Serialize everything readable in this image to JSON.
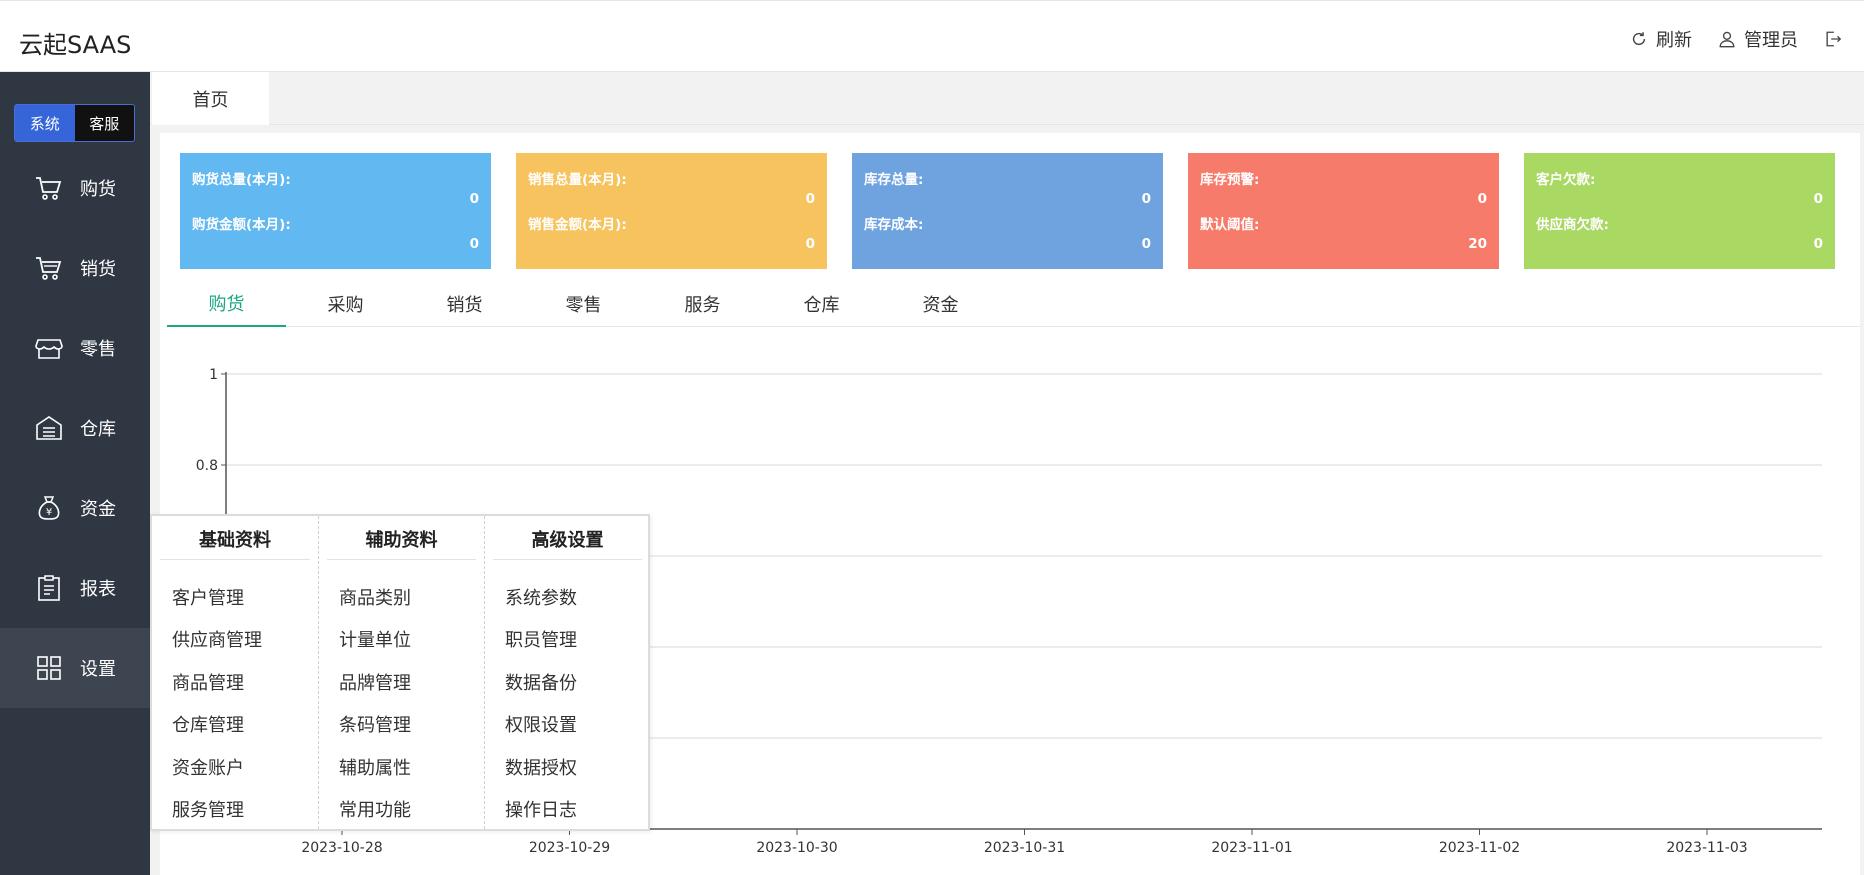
{
  "header": {
    "brand": "云起SAAS",
    "refresh": "刷新",
    "user": "管理员"
  },
  "sidebar": {
    "switch": [
      "系统",
      "客服"
    ],
    "items": [
      {
        "label": "购货",
        "icon": "cart-icon"
      },
      {
        "label": "销货",
        "icon": "cart-icon"
      },
      {
        "label": "零售",
        "icon": "store-icon"
      },
      {
        "label": "仓库",
        "icon": "warehouse-icon"
      },
      {
        "label": "资金",
        "icon": "money-bag-icon"
      },
      {
        "label": "报表",
        "icon": "clipboard-icon"
      },
      {
        "label": "设置",
        "icon": "grid-icon"
      }
    ],
    "active": "设置"
  },
  "page_tabs": [
    "首页"
  ],
  "cards": [
    {
      "color": "#62b8f0",
      "label1": "购货总量(本月):",
      "value1": "0",
      "label2": "购货金额(本月):",
      "value2": "0"
    },
    {
      "color": "#f6c35f",
      "label1": "销售总量(本月):",
      "value1": "0",
      "label2": "销售金额(本月):",
      "value2": "0"
    },
    {
      "color": "#6fa3e0",
      "label1": "库存总量:",
      "value1": "0",
      "label2": "库存成本:",
      "value2": "0"
    },
    {
      "color": "#f77b6a",
      "label1": "库存预警:",
      "value1": "0",
      "label2": "默认阈值:",
      "value2": "20"
    },
    {
      "color": "#a9d863",
      "label1": "客户欠款:",
      "value1": "0",
      "label2": "供应商欠款:",
      "value2": "0"
    }
  ],
  "section_tabs": [
    "购货",
    "采购",
    "销货",
    "零售",
    "服务",
    "仓库",
    "资金"
  ],
  "active_section_tab": "购货",
  "chart_data": {
    "type": "line",
    "x": [
      "2023-10-28",
      "2023-10-29",
      "2023-10-30",
      "2023-10-31",
      "2023-11-01",
      "2023-11-02",
      "2023-11-03"
    ],
    "y_ticks_visible": [
      1,
      0.8
    ],
    "ylim": [
      0,
      1
    ],
    "grid": true,
    "series": [
      {
        "values": [
          0,
          0,
          0,
          0,
          0,
          0,
          0
        ]
      }
    ]
  },
  "dropdown": {
    "columns": [
      {
        "title": "基础资料",
        "items": [
          "客户管理",
          "供应商管理",
          "商品管理",
          "仓库管理",
          "资金账户",
          "服务管理"
        ]
      },
      {
        "title": "辅助资料",
        "items": [
          "商品类别",
          "计量单位",
          "品牌管理",
          "条码管理",
          "辅助属性",
          "常用功能"
        ]
      },
      {
        "title": "高级设置",
        "items": [
          "系统参数",
          "职员管理",
          "数据备份",
          "权限设置",
          "数据授权",
          "操作日志"
        ]
      }
    ]
  }
}
